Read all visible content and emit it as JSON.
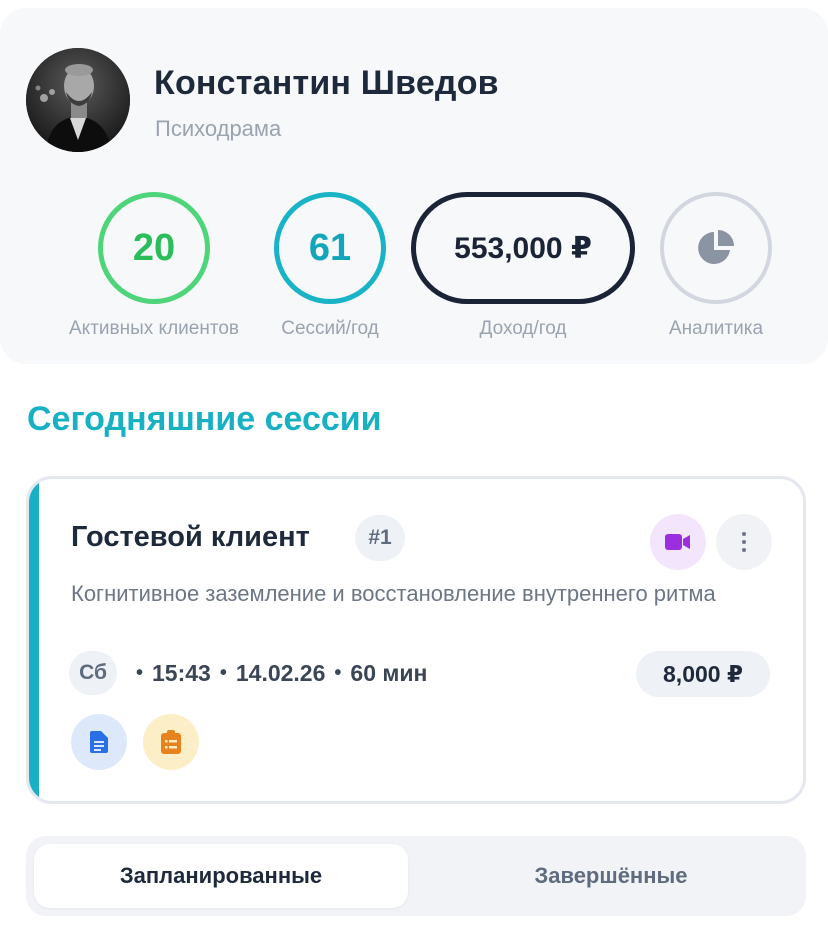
{
  "profile": {
    "name": "Константин Шведов",
    "specialty": "Психодрама"
  },
  "stats": {
    "active_clients": {
      "value": "20",
      "label": "Активных клиентов",
      "color": "#4ed47a"
    },
    "sessions": {
      "value": "61",
      "label": "Сессий/год",
      "color": "#19b3c6"
    },
    "income": {
      "value": "553,000 ₽",
      "label": "Доход/год",
      "color": "#1a2436"
    },
    "analytics": {
      "label": "Аналитика",
      "icon": "pie-chart-icon"
    }
  },
  "today": {
    "title": "Сегодняшние сессии"
  },
  "session": {
    "client_name": "Гостевой клиент",
    "number": "#1",
    "description": "Когнитивное заземление и восстановление внутреннего ритма",
    "day": "Сб",
    "time": "15:43",
    "date": "14.02.26",
    "duration": "60 мин",
    "separator": "•",
    "price": "8,000 ₽",
    "accent_color": "#18b1c4",
    "icons": [
      "video-icon",
      "more-vertical-icon",
      "document-icon",
      "clipboard-icon"
    ]
  },
  "tabs": {
    "planned": "Запланированные",
    "completed": "Завершённые",
    "active": "planned"
  }
}
